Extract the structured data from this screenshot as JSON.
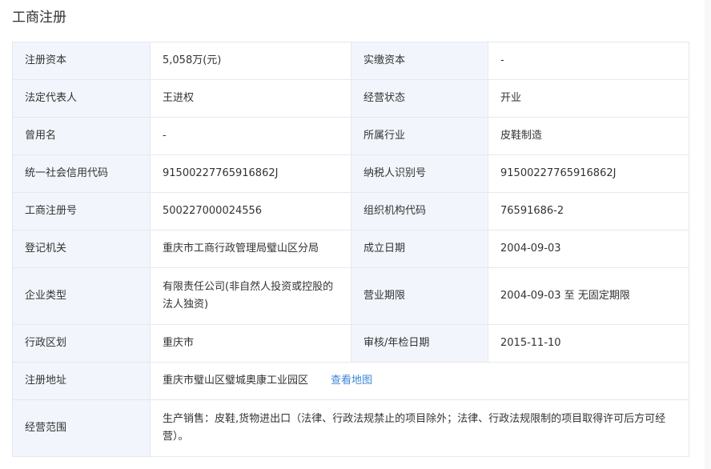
{
  "section": {
    "title": "工商注册"
  },
  "rows": [
    {
      "label1": "注册资本",
      "value1": "5,058万(元)",
      "label2": "实缴资本",
      "value2": "-"
    },
    {
      "label1": "法定代表人",
      "value1": "王进权",
      "label2": "经营状态",
      "value2": "开业"
    },
    {
      "label1": "曾用名",
      "value1": "-",
      "label2": "所属行业",
      "value2": "皮鞋制造"
    },
    {
      "label1": "统一社会信用代码",
      "value1": "91500227765916862J",
      "label2": "纳税人识别号",
      "value2": "91500227765916862J"
    },
    {
      "label1": "工商注册号",
      "value1": "500227000024556",
      "label2": "组织机构代码",
      "value2": "76591686-2"
    },
    {
      "label1": "登记机关",
      "value1": "重庆市工商行政管理局璧山区分局",
      "label2": "成立日期",
      "value2": "2004-09-03"
    },
    {
      "label1": "企业类型",
      "value1": "有限责任公司(非自然人投资或控股的法人独资)",
      "label2": "营业期限",
      "value2": "2004-09-03 至 无固定期限"
    },
    {
      "label1": "行政区划",
      "value1": "重庆市",
      "label2": "审核/年检日期",
      "value2": "2015-11-10"
    }
  ],
  "address": {
    "label": "注册地址",
    "value": "重庆市璧山区璧城奥康工业园区",
    "map_link": "查看地图"
  },
  "scope": {
    "label": "经营范围",
    "value": "生产销售：皮鞋,货物进出口（法律、行政法规禁止的项目除外；法律、行政法规限制的项目取得许可后方可经营）。"
  }
}
